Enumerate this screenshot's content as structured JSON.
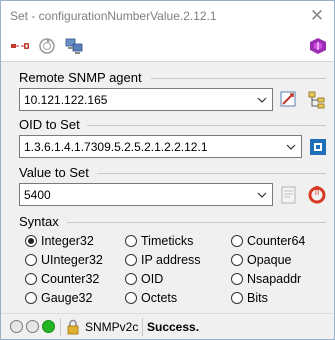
{
  "window": {
    "title": "Set - configurationNumberValue.2.12.1",
    "close_glyph": "✕"
  },
  "toolbar": {
    "icons": [
      "connection-icon",
      "refresh-icon",
      "computers-icon",
      "branding-icon"
    ]
  },
  "agent": {
    "label": "Remote SNMP agent",
    "value": "10.121.122.165"
  },
  "oid": {
    "label": "OID to Set",
    "value": "1.3.6.1.4.1.7309.5.2.5.2.1.2.2.12.1"
  },
  "set_value": {
    "label": "Value to Set",
    "value": "5400"
  },
  "syntax": {
    "label": "Syntax",
    "options": [
      "Integer32",
      "Timeticks",
      "Counter64",
      "UInteger32",
      "IP address",
      "Opaque",
      "Counter32",
      "OID",
      "Nsapaddr",
      "Gauge32",
      "Octets",
      "Bits"
    ],
    "selected": "Integer32"
  },
  "status": {
    "led_colors": [
      "#e6e6e6",
      "#e6e6e6",
      "#22b422"
    ],
    "protocol": "SNMPv2c",
    "message": "Success."
  }
}
